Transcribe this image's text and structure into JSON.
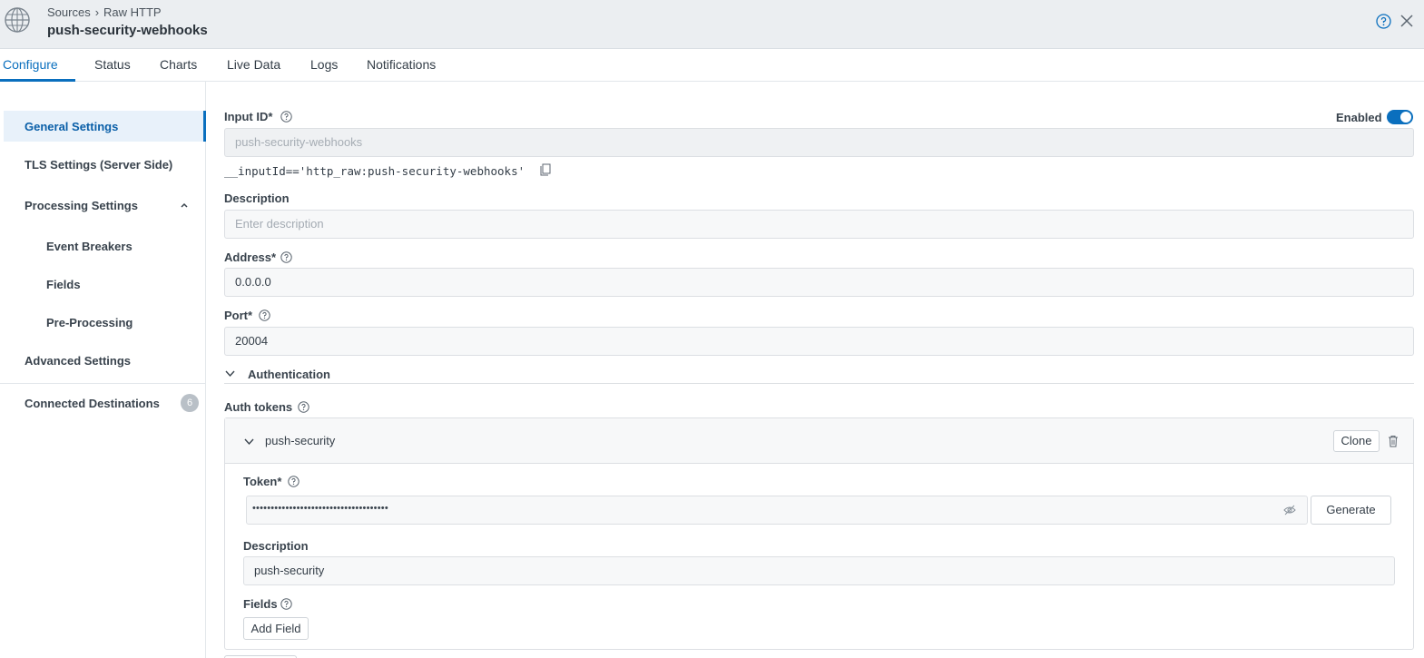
{
  "header": {
    "breadcrumb": [
      "Sources",
      "Raw HTTP"
    ],
    "breadcrumb_sep": "›",
    "title": "push-security-webhooks",
    "icons": [
      "globe-icon",
      "help-icon",
      "close-icon"
    ]
  },
  "tabs": [
    {
      "label": "Configure",
      "active": true
    },
    {
      "label": "Status"
    },
    {
      "label": "Charts"
    },
    {
      "label": "Live Data"
    },
    {
      "label": "Logs"
    },
    {
      "label": "Notifications"
    }
  ],
  "sidebar": {
    "items": [
      {
        "label": "General Settings",
        "active": true
      },
      {
        "label": "TLS Settings (Server Side)"
      },
      {
        "label": "Processing Settings",
        "expanded": true
      },
      {
        "label": "Event Breakers"
      },
      {
        "label": "Fields"
      },
      {
        "label": "Pre-Processing"
      },
      {
        "label": "Advanced Settings"
      },
      {
        "label": "Connected Destinations",
        "badge": "6"
      }
    ]
  },
  "form": {
    "input_id": {
      "label": "Input ID*",
      "value": "push-security-webhooks"
    },
    "enabled": {
      "label": "Enabled",
      "on": true
    },
    "input_id_expr": "__inputId=='http_raw:push-security-webhooks'",
    "description": {
      "label": "Description",
      "placeholder": "Enter description"
    },
    "address": {
      "label": "Address*",
      "value": "0.0.0.0"
    },
    "port": {
      "label": "Port*",
      "value": "20004"
    },
    "authentication": {
      "label": "Authentication"
    },
    "auth_tokens": {
      "label": "Auth tokens",
      "item": {
        "name": "push-security",
        "clone_label": "Clone",
        "token": {
          "label": "Token*",
          "masked": "•••••••••••••••••••••••••••••••••••••"
        },
        "generate_label": "Generate",
        "description": {
          "label": "Description",
          "value": "push-security"
        },
        "fields": {
          "label": "Fields"
        },
        "add_field_label": "Add Field"
      }
    }
  },
  "colors": {
    "accent": "#0a6fbe",
    "header_bg": "#ebeef1",
    "active_bg": "#e8f1fa"
  }
}
